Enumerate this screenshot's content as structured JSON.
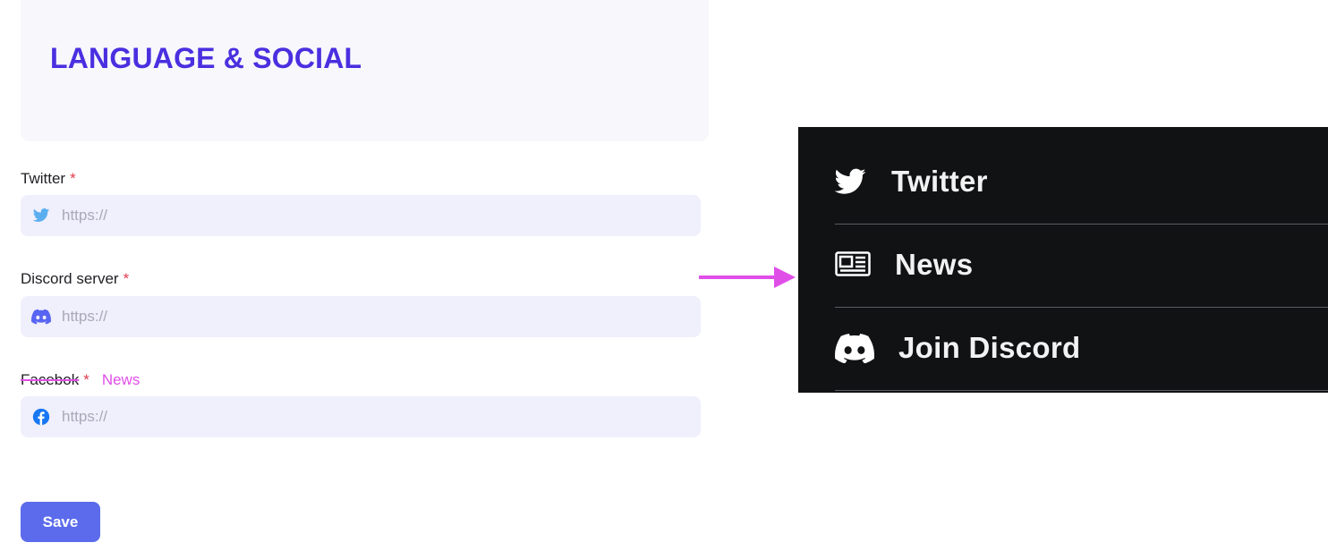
{
  "header": {
    "title": "LANGUAGE & SOCIAL"
  },
  "fields": {
    "twitter": {
      "label": "Twitter",
      "required_mark": "*",
      "value": "",
      "placeholder": "https://"
    },
    "discord": {
      "label": "Discord server",
      "required_mark": "*",
      "value": "",
      "placeholder": "https://"
    },
    "facebook": {
      "label": "Facebok",
      "required_mark": "*",
      "annotation": "News",
      "value": "",
      "placeholder": "https://"
    }
  },
  "save_label": "Save",
  "menu": {
    "items": [
      {
        "label": "Twitter",
        "icon": "twitter-icon"
      },
      {
        "label": "News",
        "icon": "newspaper-icon"
      },
      {
        "label": "Join Discord",
        "icon": "discord-icon"
      }
    ]
  },
  "colors": {
    "title": "#4a2fe0",
    "annotation": "#e04ee8",
    "button": "#5b6bec",
    "dark_panel": "#111214"
  }
}
